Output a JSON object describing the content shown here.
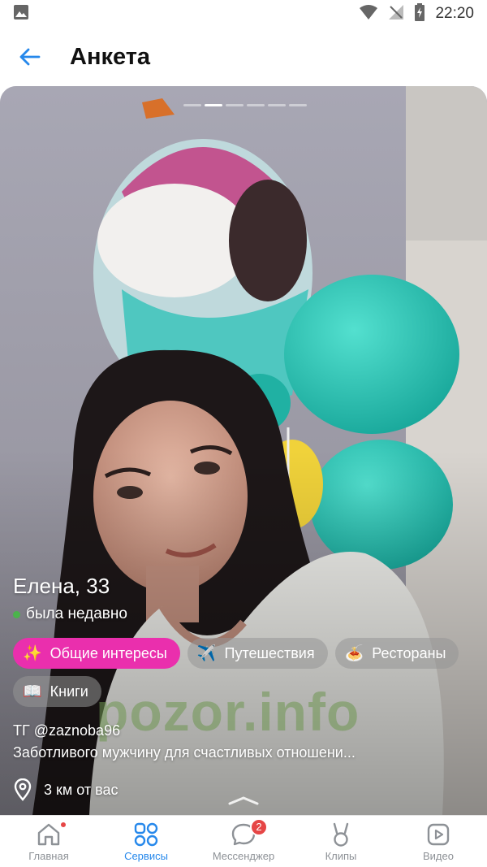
{
  "status_bar": {
    "time": "22:20"
  },
  "header": {
    "title": "Анкета"
  },
  "profile": {
    "name_age": "Елена, 33",
    "online_status": "была недавно",
    "photo_count": 6,
    "current_photo": 2,
    "tags": [
      {
        "emoji": "✨",
        "label": "Общие интересы",
        "accent": true
      },
      {
        "emoji": "✈️",
        "label": "Путешествия",
        "accent": false
      },
      {
        "emoji": "🍝",
        "label": "Рестораны",
        "accent": false
      },
      {
        "emoji": "📖",
        "label": "Книги",
        "accent": false
      }
    ],
    "bio_line1": "ТГ @zaznoba96",
    "bio_line2": "Заботливого мужчину для счастливых отношени...",
    "distance": "3 км от вас"
  },
  "watermark": "pozor.info",
  "bottom_nav": [
    {
      "label": "Главная",
      "icon": "home-icon",
      "active": false
    },
    {
      "label": "Сервисы",
      "icon": "services-icon",
      "active": true
    },
    {
      "label": "Мессенджер",
      "icon": "messenger-icon",
      "active": false,
      "badge": "2"
    },
    {
      "label": "Клипы",
      "icon": "clips-icon",
      "active": false
    },
    {
      "label": "Видео",
      "icon": "video-icon",
      "active": false
    }
  ],
  "colors": {
    "accent": "#2688eb",
    "tag_accent": "#ea2fad",
    "online": "#4bb34b",
    "badge": "#e64646"
  }
}
